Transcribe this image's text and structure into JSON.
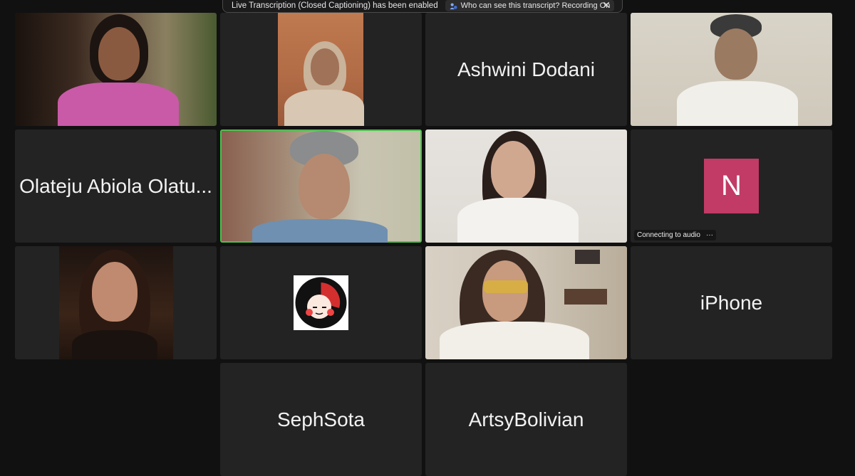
{
  "banner": {
    "message": "Live Transcription (Closed Captioning) has been enabled",
    "who_link": "Who can see this transcript? Recording On",
    "close_glyph": "✕"
  },
  "tiles": {
    "ashwini": {
      "name": "Ashwini Dodani"
    },
    "olateju": {
      "name": "Olateju Abiola Olatu..."
    },
    "iphone": {
      "name": "iPhone"
    },
    "sephsota": {
      "name": "SephSota"
    },
    "artsy": {
      "name": "ArtsyBolivian"
    },
    "n_user": {
      "initial": "N",
      "status": "Connecting to audio",
      "more_glyph": "···"
    }
  },
  "colors": {
    "active_speaker_border": "#4fbf4f",
    "avatar_n": "#c23a66",
    "tile_bg": "#232323"
  },
  "icons": [
    "shield-user-icon",
    "close-icon",
    "more-icon"
  ]
}
